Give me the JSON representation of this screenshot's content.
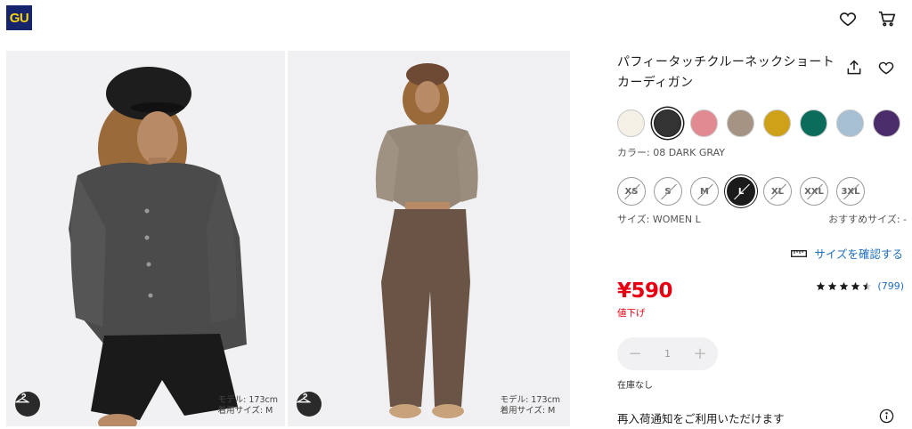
{
  "header": {
    "logo_text": "GU",
    "wishlist_icon": "heart-icon",
    "cart_icon": "cart-icon"
  },
  "gallery": {
    "images": [
      {
        "alt": "model wearing dark gray cardigan with black beret",
        "hanger_icon": "hanger-icon",
        "model_height": "モデル: 173cm",
        "model_size": "着用サイズ: M"
      },
      {
        "alt": "model wearing beige cardigan with brown cap and jeans",
        "hanger_icon": "hanger-icon",
        "model_height": "モデル: 173cm",
        "model_size": "着用サイズ: M"
      }
    ]
  },
  "product": {
    "title": "パフィータッチクルーネックショートカーディガン",
    "share_icon": "share-icon",
    "favorite_icon": "heart-icon",
    "colors": [
      {
        "hex": "#f4f0e6",
        "selected": false
      },
      {
        "hex": "#333333",
        "selected": true
      },
      {
        "hex": "#e28a91",
        "selected": false
      },
      {
        "hex": "#a59384",
        "selected": false
      },
      {
        "hex": "#cfa119",
        "selected": false
      },
      {
        "hex": "#0b6c5b",
        "selected": false
      },
      {
        "hex": "#a6bfd3",
        "selected": false
      },
      {
        "hex": "#4a2c6a",
        "selected": false
      }
    ],
    "color_label": "カラー: 08 DARK GRAY",
    "sizes": [
      {
        "label": "XS",
        "selected": false
      },
      {
        "label": "S",
        "selected": false
      },
      {
        "label": "M",
        "selected": false
      },
      {
        "label": "L",
        "selected": true
      },
      {
        "label": "XL",
        "selected": false
      },
      {
        "label": "XXL",
        "selected": false
      },
      {
        "label": "3XL",
        "selected": false
      }
    ],
    "size_label": "サイズ: WOMEN L",
    "recommended_size": "おすすめサイズ: -",
    "size_check_label": "サイズを確認する",
    "size_check_icon": "ruler-icon",
    "price": "¥590",
    "price_tag": "値下げ",
    "rating": 4.5,
    "review_count": "(799)",
    "quantity": "1",
    "qty_minus": "−",
    "qty_plus": "+",
    "stock_status": "在庫なし",
    "restock_notice": "再入荷通知をご利用いただけます",
    "restock_icon": "info-icon"
  },
  "colors": {
    "price_red": "#e60012",
    "link_blue": "#1c6ebf",
    "logo_bg": "#16246b",
    "logo_text": "#f4d20c"
  }
}
